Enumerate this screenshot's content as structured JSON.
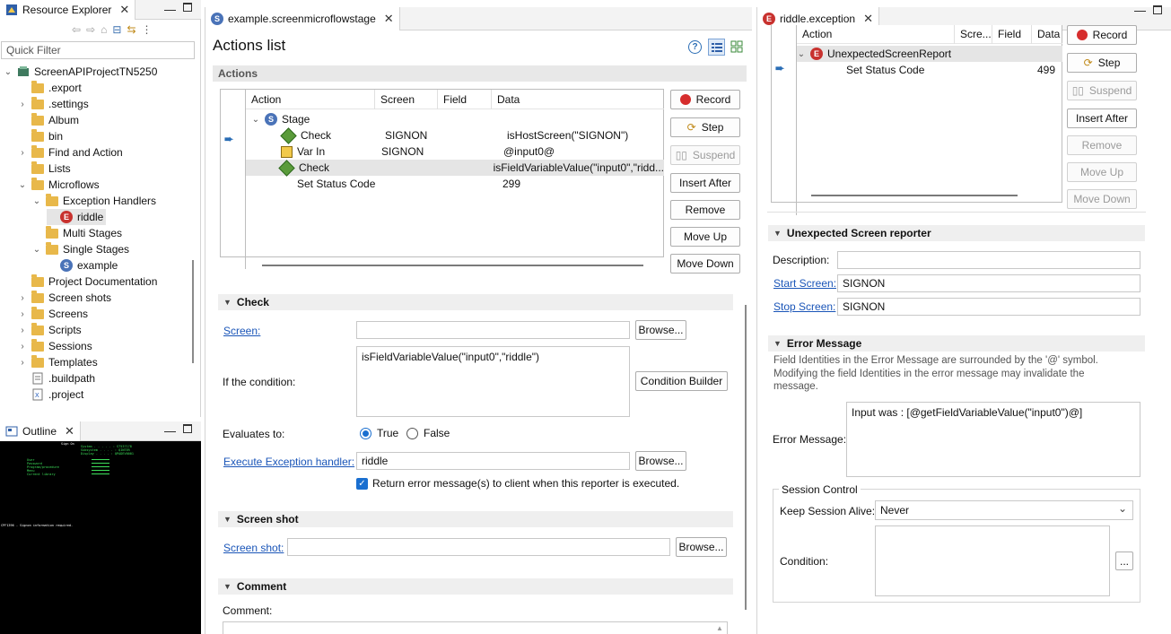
{
  "resource_explorer": {
    "title": "Resource Explorer",
    "quick_filter": "Quick Filter",
    "tree": [
      {
        "label": "ScreenAPIProjectTN5250",
        "icon": "project-icon"
      },
      {
        "label": ".export"
      },
      {
        "label": ".settings"
      },
      {
        "label": "Album"
      },
      {
        "label": "bin"
      },
      {
        "label": "Find and Action"
      },
      {
        "label": "Lists"
      },
      {
        "label": "Microflows"
      },
      {
        "label": "Exception Handlers"
      },
      {
        "label": "riddle"
      },
      {
        "label": "Multi Stages"
      },
      {
        "label": "Single Stages"
      },
      {
        "label": "example"
      },
      {
        "label": "Project Documentation"
      },
      {
        "label": "Screen shots"
      },
      {
        "label": "Screens"
      },
      {
        "label": "Scripts"
      },
      {
        "label": "Sessions"
      },
      {
        "label": "Templates"
      },
      {
        "label": ".buildpath"
      },
      {
        "label": ".project"
      }
    ]
  },
  "outline": {
    "title": "Outline",
    "preview_lines": [
      "Sign On",
      "System . . . . . :  S7537178",
      "Subsystem . . . . :  QINTER",
      "Display  . . . . :  QPADEV0001",
      "User",
      "Password",
      "Program/procedure",
      "Menu",
      "Current library",
      "CPF1396 - Signon information required."
    ]
  },
  "editor1": {
    "tab": "example.screenmicroflowstage",
    "title": "Actions list",
    "actions_section": "Actions",
    "columns": [
      "Action",
      "Screen",
      "Field",
      "Data"
    ],
    "rows": [
      {
        "action": "Stage",
        "screen": "",
        "field": "",
        "data": ""
      },
      {
        "action": "Check",
        "screen": "SIGNON",
        "field": "",
        "data": "isHostScreen(\"SIGNON\")"
      },
      {
        "action": "Var In",
        "screen": "SIGNON",
        "field": "",
        "data": "@input0@"
      },
      {
        "action": "Check",
        "screen": "",
        "field": "",
        "data": "isFieldVariableValue(\"input0\",\"ridd..."
      },
      {
        "action": "Set Status Code",
        "screen": "",
        "field": "",
        "data": "299"
      }
    ],
    "buttons": {
      "record": "Record",
      "step": "Step",
      "suspend": "Suspend",
      "insert_after": "Insert After",
      "remove": "Remove",
      "move_up": "Move Up",
      "move_down": "Move Down"
    },
    "check": {
      "section": "Check",
      "screen_label": "Screen:",
      "screen_value": "",
      "browse": "Browse...",
      "condition_label": "If the condition:",
      "condition_value": "isFieldVariableValue(\"input0\",\"riddle\")",
      "condition_builder": "Condition Builder",
      "evaluates_label": "Evaluates to:",
      "true_label": "True",
      "false_label": "False",
      "exception_label": "Execute Exception handler:",
      "exception_value": "riddle",
      "browse2": "Browse...",
      "return_error": "Return error message(s) to client when this reporter is executed."
    },
    "screenshot": {
      "section": "Screen shot",
      "label": "Screen shot:",
      "value": "",
      "browse": "Browse..."
    },
    "comment": {
      "section": "Comment",
      "label": "Comment:"
    }
  },
  "editor2": {
    "tab": "riddle.exception",
    "columns": [
      "Action",
      "Scre...",
      "Field",
      "Data"
    ],
    "rows": [
      {
        "action": "UnexpectedScreenReport",
        "screen": "",
        "field": "",
        "data": ""
      },
      {
        "action": "Set Status Code",
        "screen": "",
        "field": "",
        "data": "499"
      }
    ],
    "buttons": {
      "record": "Record",
      "step": "Step",
      "suspend": "Suspend",
      "insert_after": "Insert After",
      "remove": "Remove",
      "move_up": "Move Up",
      "move_down": "Move Down"
    },
    "reporter": {
      "section": "Unexpected Screen reporter",
      "description_label": "Description:",
      "description_value": "",
      "start_label": "Start Screen:",
      "start_value": "SIGNON",
      "stop_label": "Stop Screen:",
      "stop_value": "SIGNON"
    },
    "error": {
      "section": "Error Message",
      "help": "Field Identities in the Error Message are surrounded by the '@' symbol. Modifying the field Identities in the error message may invalidate the message.",
      "label": "Error Message:",
      "value": "Input was : [@getFieldVariableValue(\"input0\")@]"
    },
    "session": {
      "group": "Session Control",
      "keep_label": "Keep Session Alive:",
      "keep_value": "Never",
      "condition_label": "Condition:",
      "ellipsis": "..."
    }
  }
}
